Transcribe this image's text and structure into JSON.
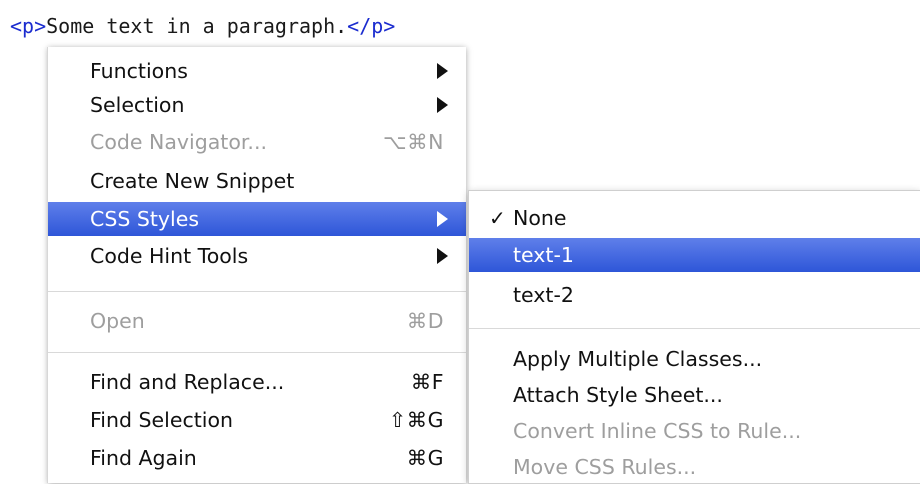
{
  "code": {
    "open_tag": "<p>",
    "text": "Some text in a paragraph.",
    "close_tag": "</p>"
  },
  "context_menu": {
    "items": [
      {
        "label": "Functions"
      },
      {
        "label": "Selection"
      },
      {
        "label": "Code Navigator...",
        "shortcut": "⌥⌘N",
        "disabled": true
      },
      {
        "label": "Create New Snippet"
      },
      {
        "label": "CSS Styles",
        "highlighted": true
      },
      {
        "label": "Code Hint Tools"
      },
      {
        "label": "Open",
        "shortcut": "⌘D",
        "disabled": true
      },
      {
        "label": "Find and Replace...",
        "shortcut": "⌘F"
      },
      {
        "label": "Find Selection",
        "shortcut": "⇧⌘G"
      },
      {
        "label": "Find Again",
        "shortcut": "⌘G"
      }
    ]
  },
  "css_styles_submenu": {
    "items": [
      {
        "label": "None",
        "checked": true,
        "check_mark": "✓"
      },
      {
        "label": "text-1",
        "highlighted": true
      },
      {
        "label": "text-2"
      },
      {
        "label": "Apply Multiple Classes..."
      },
      {
        "label": "Attach Style Sheet..."
      },
      {
        "label": "Convert Inline CSS to Rule...",
        "disabled": true
      },
      {
        "label": "Move CSS Rules...",
        "disabled": true
      }
    ]
  },
  "colors": {
    "highlight": "#2e56d8",
    "tag": "#1b2ccf",
    "disabled_text": "#9e9e9e"
  }
}
